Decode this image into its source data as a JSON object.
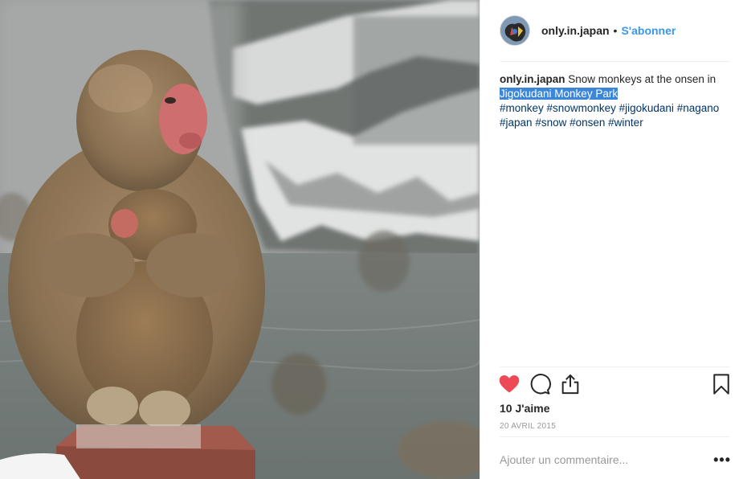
{
  "post": {
    "username": "only.in.japan",
    "separator": "•",
    "follow_label": "S'abonner",
    "caption": {
      "username": "only.in.japan",
      "text": "Snow monkeys at the onsen in",
      "location": "Jigokudani Monkey Park",
      "hashtags": [
        "#monkey",
        "#snowmonkey",
        "#jigokudani",
        "#nagano",
        "#japan",
        "#snow",
        "#onsen",
        "#winter"
      ]
    },
    "likes": "10 J'aime",
    "date": "20 AVRIL 2015",
    "comment_placeholder": "Ajouter un commentaire...",
    "more_label": "•••"
  },
  "icons": {
    "like": "heart-filled-icon",
    "comment": "speech-bubble-icon",
    "share": "share-upload-icon",
    "save": "bookmark-icon",
    "more": "more-options-icon"
  },
  "colors": {
    "follow": "#3897f0",
    "like_heart": "#ed4956",
    "hashtag": "#003569",
    "location_highlight": "#3b86d8"
  }
}
